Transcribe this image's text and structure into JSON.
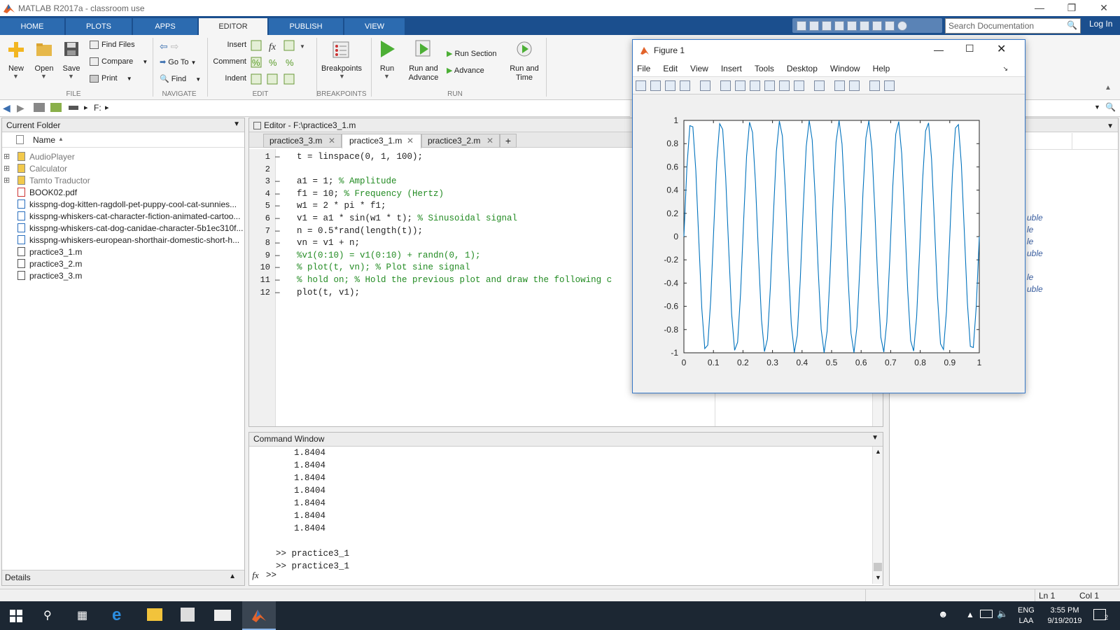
{
  "window": {
    "title": "MATLAB R2017a - classroom use"
  },
  "toolstrip": {
    "tabs": [
      "HOME",
      "PLOTS",
      "APPS",
      "EDITOR",
      "PUBLISH",
      "VIEW"
    ],
    "search_placeholder": "Search Documentation",
    "login": "Log In"
  },
  "ribbon": {
    "file": {
      "new": "New",
      "open": "Open",
      "save": "Save",
      "find_files": "Find Files",
      "compare": "Compare",
      "print": "Print",
      "group": "FILE"
    },
    "navigate": {
      "go_to": "Go To",
      "find": "Find",
      "group": "NAVIGATE"
    },
    "edit": {
      "insert": "Insert",
      "comment": "Comment",
      "indent": "Indent",
      "group": "EDIT"
    },
    "breakpoints": {
      "breakpoints": "Breakpoints",
      "group": "BREAKPOINTS"
    },
    "run": {
      "run": "Run",
      "run_and_advance_1": "Run and",
      "run_and_advance_2": "Advance",
      "run_section": "Run Section",
      "advance": "Advance",
      "run_and_time_1": "Run and",
      "run_and_time_2": "Time",
      "group": "RUN"
    }
  },
  "address": {
    "path": "F:"
  },
  "current_folder": {
    "title": "Current Folder",
    "column": "Name",
    "items": [
      {
        "name": "AudioPlayer",
        "type": "folder"
      },
      {
        "name": "Calculator",
        "type": "folder"
      },
      {
        "name": "Tamto Traductor",
        "type": "folder"
      },
      {
        "name": "BOOK02.pdf",
        "type": "pdf"
      },
      {
        "name": "kisspng-dog-kitten-ragdoll-pet-puppy-cool-cat-sunnies...",
        "type": "image"
      },
      {
        "name": "kisspng-whiskers-cat-character-fiction-animated-cartoo...",
        "type": "image"
      },
      {
        "name": "kisspng-whiskers-cat-dog-canidae-character-5b1ec310f...",
        "type": "image"
      },
      {
        "name": "kisspng-whiskers-european-shorthair-domestic-short-h...",
        "type": "image"
      },
      {
        "name": "practice3_1.m",
        "type": "mfile"
      },
      {
        "name": "practice3_2.m",
        "type": "mfile"
      },
      {
        "name": "practice3_3.m",
        "type": "mfile"
      }
    ],
    "details": "Details"
  },
  "editor": {
    "title": "Editor - F:\\practice3_1.m",
    "tabs": [
      "practice3_3.m",
      "practice3_1.m",
      "practice3_2.m"
    ],
    "active_tab": 1,
    "lines": [
      {
        "n": "1",
        "code": "t = linspace(0, 1, 100);",
        "comment": ""
      },
      {
        "n": "2",
        "code": "",
        "comment": ""
      },
      {
        "n": "3",
        "code": "a1 = 1; ",
        "comment": "% Amplitude"
      },
      {
        "n": "4",
        "code": "f1 = 10; ",
        "comment": "% Frequency (Hertz)"
      },
      {
        "n": "5",
        "code": "w1 = 2 * pi * f1;",
        "comment": ""
      },
      {
        "n": "6",
        "code": "v1 = a1 * sin(w1 * t); ",
        "comment": "% Sinusoidal signal"
      },
      {
        "n": "7",
        "code": "n = 0.5*rand(length(t));",
        "comment": ""
      },
      {
        "n": "8",
        "code": "vn = v1 + n;",
        "comment": ""
      },
      {
        "n": "9",
        "code": "",
        "comment": "%v1(0:10) = v1(0:10) + randn(0, 1);"
      },
      {
        "n": "10",
        "code": "",
        "comment": "% plot(t, vn); % Plot sine signal"
      },
      {
        "n": "11",
        "code": "",
        "comment": "% hold on; % Hold the previous plot and draw the following c"
      },
      {
        "n": "12",
        "code": "plot(t, v1);",
        "comment": ""
      }
    ]
  },
  "command_window": {
    "title": "Command Window",
    "outputs": [
      "1.8404",
      "1.8404",
      "1.8404",
      "1.8404",
      "1.8404",
      "1.8404",
      "1.8404"
    ],
    "history": [
      ">> practice3_1",
      ">> practice3_1"
    ],
    "prompt": ">>"
  },
  "workspace_fragments": [
    "uble",
    "le",
    "le",
    "uble",
    "le",
    "uble"
  ],
  "statusbar": {
    "ln": "Ln  1",
    "col": "Col  1"
  },
  "figure": {
    "title": "Figure 1",
    "menu": [
      "File",
      "Edit",
      "View",
      "Insert",
      "Tools",
      "Desktop",
      "Window",
      "Help"
    ]
  },
  "chart_data": {
    "type": "line",
    "function": "sin(2*pi*10*t) sampled at t = linspace(0,1,100)",
    "x_range": [
      0,
      1
    ],
    "ylim": [
      -1,
      1
    ],
    "xticks": [
      "0",
      "0.1",
      "0.2",
      "0.3",
      "0.4",
      "0.5",
      "0.6",
      "0.7",
      "0.8",
      "0.9",
      "1"
    ],
    "yticks": [
      "1",
      "0.8",
      "0.6",
      "0.4",
      "0.2",
      "0",
      "-0.2",
      "-0.4",
      "-0.6",
      "-0.8",
      "-1"
    ],
    "series": [
      {
        "color": "#0072bd",
        "amplitude": 1,
        "frequency_hz": 10,
        "samples": 100
      }
    ],
    "title": "",
    "xlabel": "",
    "ylabel": ""
  },
  "taskbar": {
    "lang1": "ENG",
    "lang2": "LAA",
    "time": "3:55 PM",
    "date": "9/19/2019",
    "notifications": "2"
  }
}
